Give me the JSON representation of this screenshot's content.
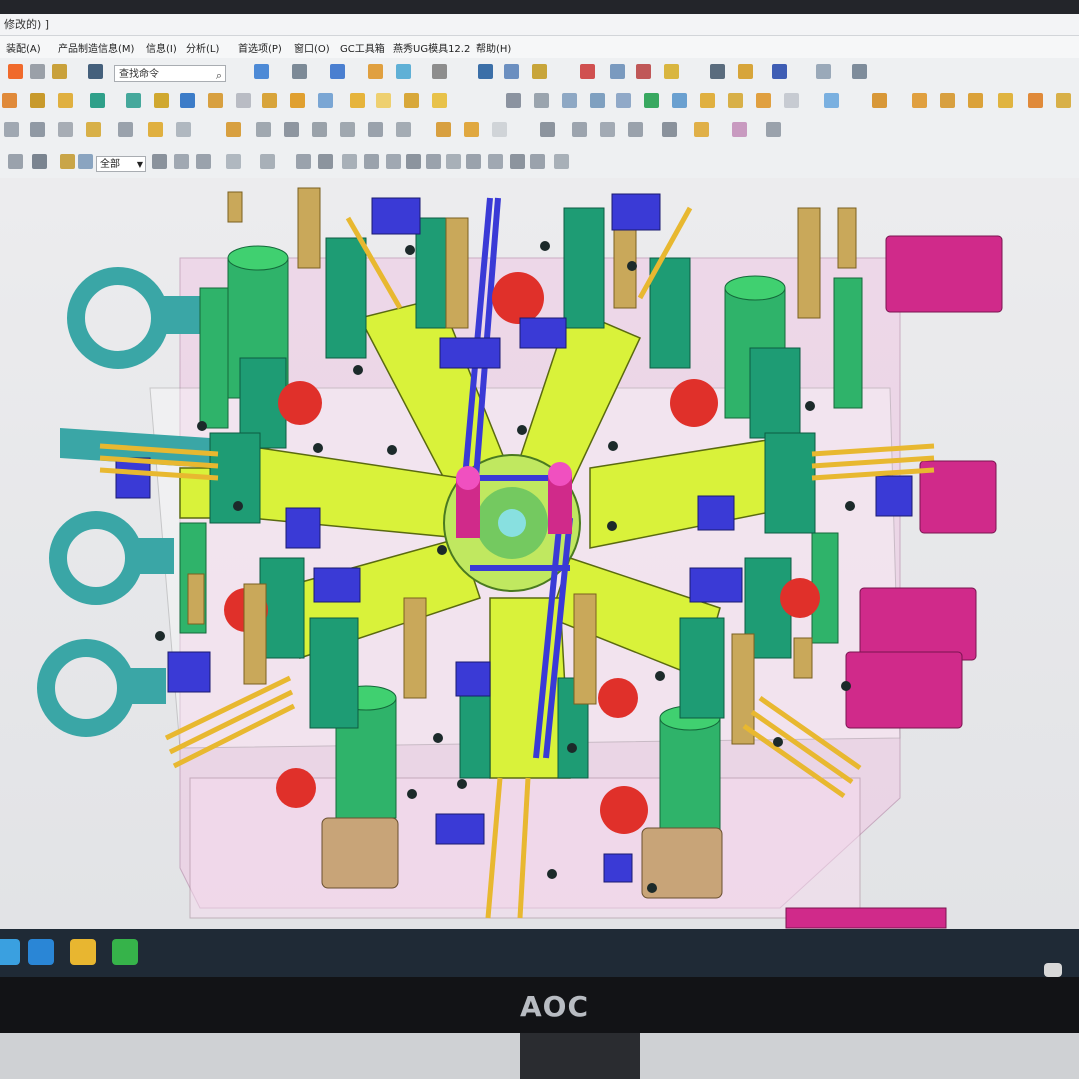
{
  "window": {
    "title": "修改的) ]"
  },
  "menu": [
    "装配(A)",
    "产品制造信息(M)",
    "信息(I)",
    "分析(L)",
    "首选项(P)",
    "窗口(O)",
    "GC工具箱",
    "燕秀UG模具12.2",
    "帮助(H)"
  ],
  "search": {
    "placeholder": "查找命令"
  },
  "filter": {
    "value": "全部"
  },
  "monitor": {
    "brand": "AOC"
  },
  "colors": {
    "accent_yellow": "#d9f23a",
    "mold_pink": "#e8a6d0",
    "green_pillar": "#2fb36a",
    "magenta_cylinder": "#d02a8a",
    "teal_eyebolt": "#3aa6a6",
    "blue_component": "#3a3ad6"
  }
}
